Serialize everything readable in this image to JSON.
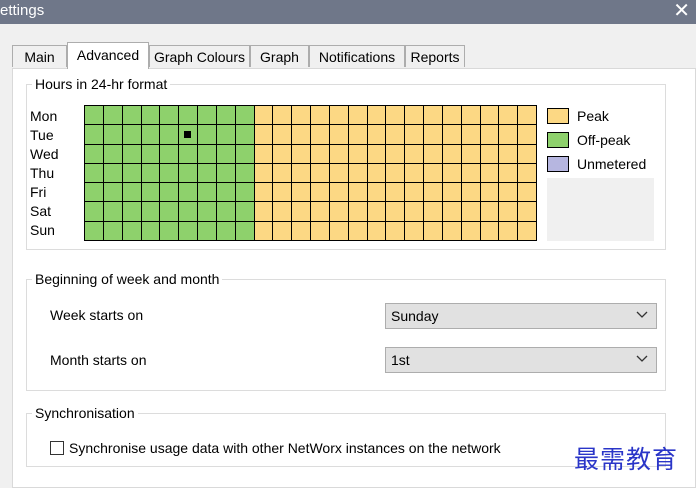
{
  "window": {
    "title": "ettings",
    "close_glyph": "✕"
  },
  "tabs": [
    {
      "label": "Main",
      "active": false
    },
    {
      "label": "Advanced",
      "active": true
    },
    {
      "label": "Graph Colours",
      "active": false
    },
    {
      "label": "Graph",
      "active": false
    },
    {
      "label": "Notifications",
      "active": false
    },
    {
      "label": "Reports",
      "active": false
    }
  ],
  "hours_group": {
    "legend": "Hours in 24-hr format",
    "days": [
      "Mon",
      "Tue",
      "Wed",
      "Thu",
      "Fri",
      "Sat",
      "Sun"
    ],
    "hours_per_day": 24,
    "offpeak_hours": [
      0,
      1,
      2,
      3,
      4,
      5,
      6,
      7,
      8
    ],
    "selected_cell": {
      "day": "Tue",
      "hour": 5
    },
    "legend_items": [
      {
        "label": "Peak",
        "color": "#fcd884"
      },
      {
        "label": "Off-peak",
        "color": "#8ed16c"
      },
      {
        "label": "Unmetered",
        "color": "#b6b6e0"
      }
    ]
  },
  "week_group": {
    "legend": "Beginning of week and month",
    "week_label": "Week starts on",
    "week_value": "Sunday",
    "month_label": "Month starts on",
    "month_value": "1st"
  },
  "sync_group": {
    "legend": "Synchronisation",
    "checkbox_label": "Synchronise usage data with other NetWorx instances on the network",
    "checked": false
  },
  "watermark": "最需教育"
}
